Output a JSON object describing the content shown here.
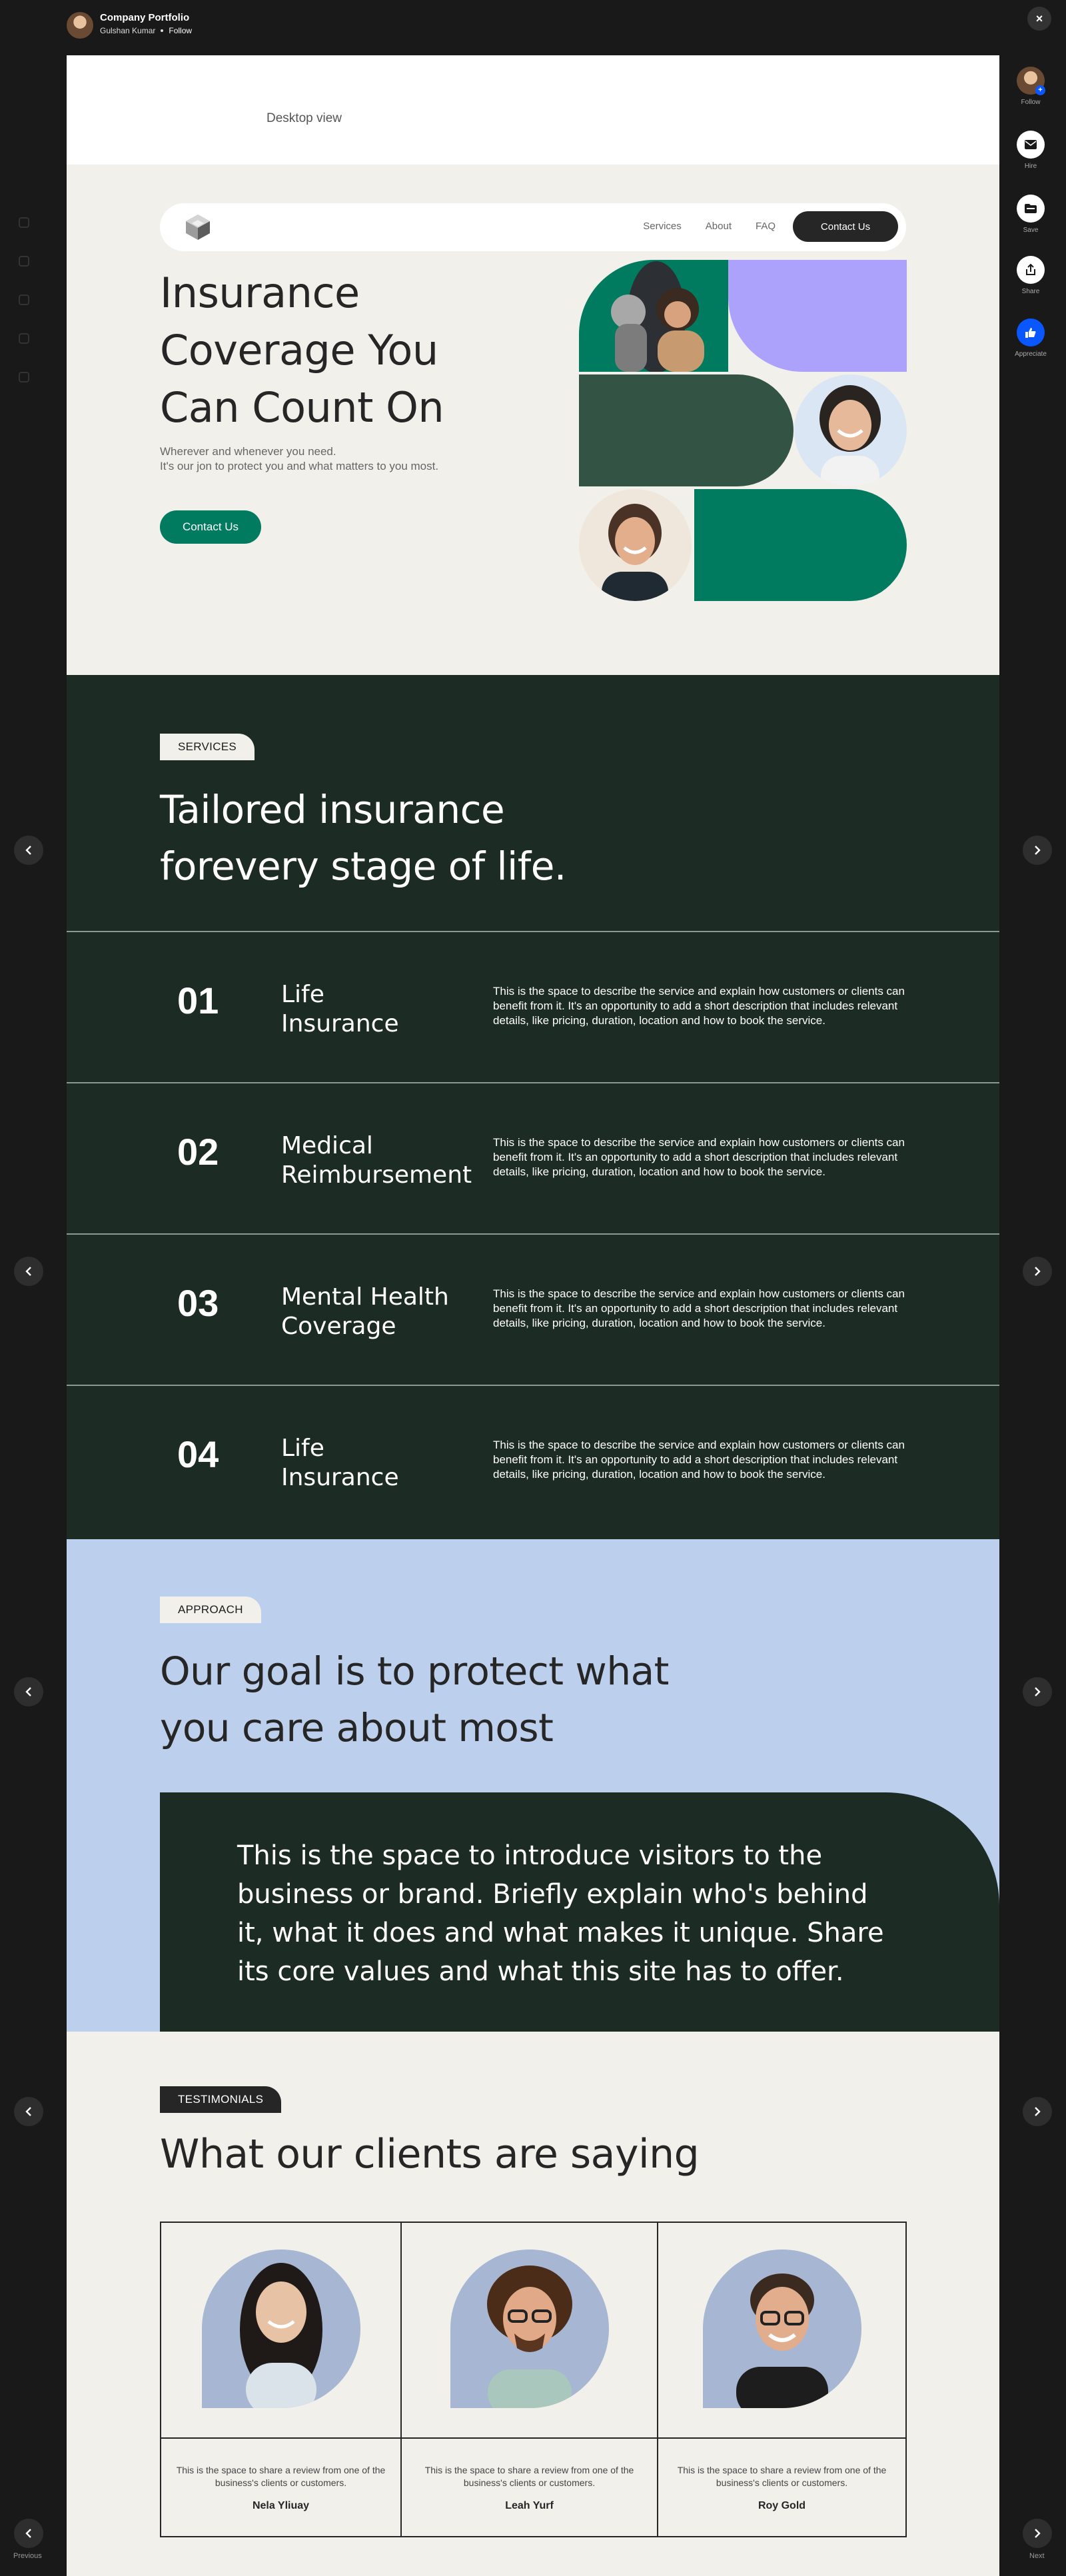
{
  "viewer": {
    "project_title": "Company Portfolio",
    "owner_name": "Gulshan Kumar",
    "follow_label": "Follow",
    "close_icon": "×",
    "rail": [
      {
        "label": "Follow",
        "icon": "avatar-plus-icon"
      },
      {
        "label": "Hire",
        "icon": "mail-icon"
      },
      {
        "label": "Save",
        "icon": "folder-icon"
      },
      {
        "label": "Share",
        "icon": "share-icon"
      },
      {
        "label": "Appreciate",
        "icon": "thumbs-up-icon"
      }
    ],
    "previous_label": "Previous",
    "next_label": "Next",
    "accent_color": "#0a57ff"
  },
  "desktop_label": "Desktop view",
  "site": {
    "nav": {
      "links": [
        "Services",
        "About",
        "FAQ"
      ],
      "contact_label": "Contact Us"
    },
    "hero": {
      "title": "Insurance Coverage You Can Count On",
      "subtitle_line1": "Wherever and whenever you need.",
      "subtitle_line2": "It's our jon to protect you and what matters to you most.",
      "cta_label": "Contact Us",
      "cta_color": "#007b5f"
    },
    "services": {
      "tag": "SERVICES",
      "title_line1": "Tailored insurance",
      "title_line2": "forevery stage of life.",
      "items": [
        {
          "number": "01",
          "name_line1": "Life",
          "name_line2": "Insurance",
          "description": "This is the space to describe the service and explain how customers or clients can benefit from it. It's an opportunity to add a short description that includes relevant details, like pricing, duration, location and how to book the service."
        },
        {
          "number": "02",
          "name_line1": "Medical",
          "name_line2": "Reimbursement",
          "description": "This is the space to describe the service and explain how customers or clients can benefit from it. It's an opportunity to add a short description that includes relevant details, like pricing, duration, location and how to book the service."
        },
        {
          "number": "03",
          "name_line1": "Mental Health",
          "name_line2": "Coverage",
          "description": "This is the space to describe the service and explain how customers or clients can benefit from it. It's an opportunity to add a short description that includes relevant details, like pricing, duration, location and how to book the service."
        },
        {
          "number": "04",
          "name_line1": "Life",
          "name_line2": "Insurance",
          "description": "This is the space to describe the service and explain how customers or clients can benefit from it. It's an opportunity to add a short description that includes relevant details, like pricing, duration, location and how to book the service."
        }
      ]
    },
    "approach": {
      "tag": "APPROACH",
      "title_line1": "Our goal is to protect what",
      "title_line2": "you care about most",
      "body": "This is the space to introduce visitors to the business or brand. Briefly explain who's behind it, what it does and what makes it unique. Share its core values and what this site has to offer."
    },
    "testimonials": {
      "tag": "TESTIMONIALS",
      "title": "What our clients are saying",
      "items": [
        {
          "quote": "This is the space to share a review from one of the business's clients or customers.",
          "name": "Nela Yliuay"
        },
        {
          "quote": "This is the space to share a review from one of the business's clients or customers.",
          "name": "Leah Yurf"
        },
        {
          "quote": "This is the space to share a review from one of the business's clients or customers.",
          "name": "Roy Gold"
        }
      ]
    }
  }
}
